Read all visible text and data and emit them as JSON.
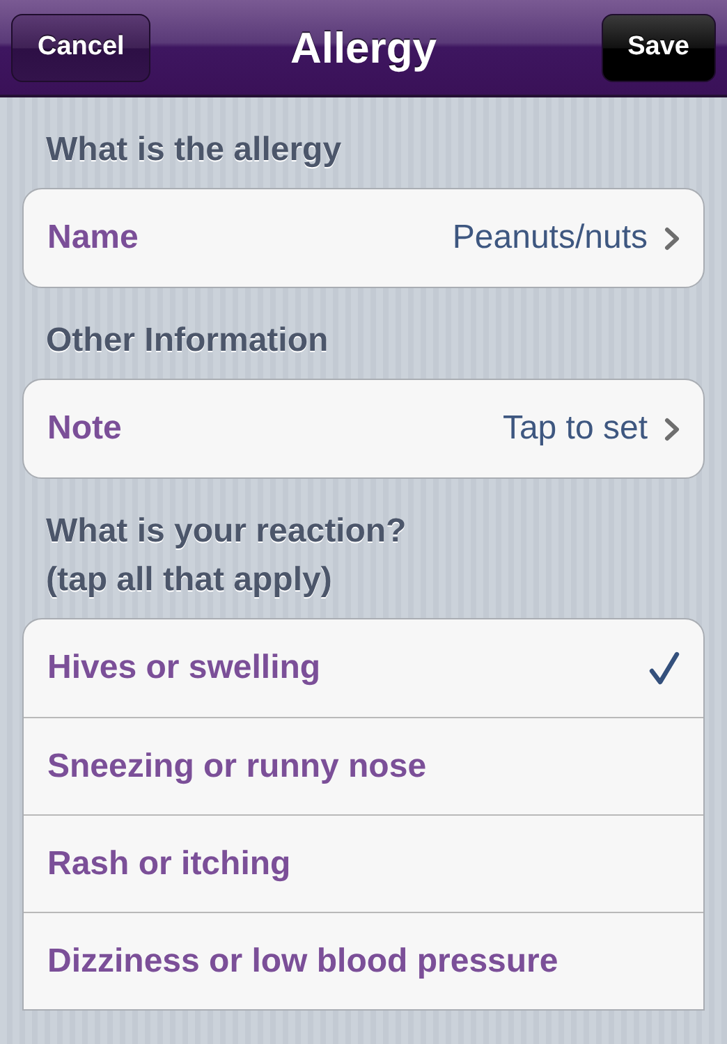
{
  "nav_bar": {
    "title": "Allergy",
    "left_button": "Cancel",
    "right_button": "Save"
  },
  "sections": [
    {
      "kind": "detail",
      "header": "What is the allergy",
      "label": "Name",
      "value": "Peanuts/nuts"
    },
    {
      "kind": "detail",
      "header": "Other Information",
      "label": "Note",
      "value": "Tap to set"
    },
    {
      "kind": "choices",
      "header": "What is your reaction?\n(tap all that apply)",
      "options": [
        {
          "label": "Hives or swelling",
          "checked": true
        },
        {
          "label": "Sneezing or runny nose",
          "checked": false
        },
        {
          "label": "Rash or itching",
          "checked": false
        },
        {
          "label": "Dizziness or low blood pressure",
          "checked": false
        }
      ]
    }
  ]
}
